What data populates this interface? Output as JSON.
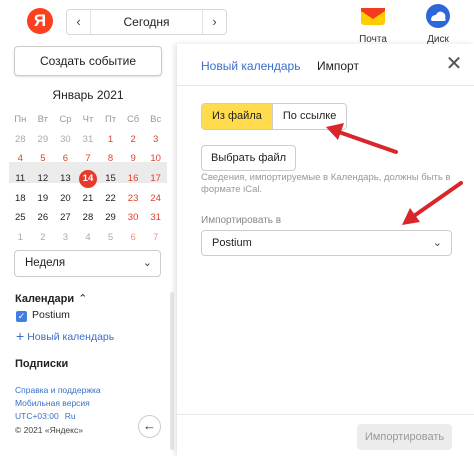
{
  "topbar": {
    "logo": "Я",
    "prev_icon": "‹",
    "today": "Сегодня",
    "next_icon": "›",
    "services": [
      {
        "label": "Почта",
        "icon": "mail-envelope-icon"
      },
      {
        "label": "Диск",
        "icon": "disk-cloud-icon"
      }
    ]
  },
  "sidebar": {
    "create_event": "Создать событие",
    "month_title": "Январь 2021",
    "weekdays": [
      "Пн",
      "Вт",
      "Ср",
      "Чт",
      "Пт",
      "Сб",
      "Вс"
    ],
    "weeks": [
      [
        "28",
        "29",
        "30",
        "31",
        "1",
        "2",
        "3"
      ],
      [
        "4",
        "5",
        "6",
        "7",
        "8",
        "9",
        "10"
      ],
      [
        "11",
        "12",
        "13",
        "14",
        "15",
        "16",
        "17"
      ],
      [
        "18",
        "19",
        "20",
        "21",
        "22",
        "23",
        "24"
      ],
      [
        "25",
        "26",
        "27",
        "28",
        "29",
        "30",
        "31"
      ],
      [
        "1",
        "2",
        "3",
        "4",
        "5",
        "6",
        "7"
      ]
    ],
    "today_date": "14",
    "view_select": "Неделя",
    "calendars_title": "Календари",
    "calendar_item": "Postium",
    "new_calendar": "Новый календарь",
    "subscriptions_title": "Подписки",
    "footer": {
      "support": "Справка и поддержка",
      "mobile": "Мобильная версия",
      "timezone": "UTC+03:00",
      "lang": "Ru",
      "copyright": "© 2021 «Яндекс»"
    },
    "collapse_icon": "←"
  },
  "panel": {
    "tab_new_calendar": "Новый календарь",
    "tab_import": "Импорт",
    "close_icon": "✕",
    "from_file": "Из файла",
    "by_link": "По ссылке",
    "choose_file": "Выбрать файл",
    "hint": "Сведения, импортируемые в Календарь, должны быть в формате iCal.",
    "import_to_label": "Импортировать в",
    "import_to_value": "Postium",
    "import_button": "Импортировать"
  },
  "colors": {
    "accent_yellow": "#ffdb4d",
    "link_blue": "#3a6fc9",
    "today_red": "#e83a2a",
    "holiday_red": "#e0402a",
    "annotation_arrow": "#d8262a"
  }
}
